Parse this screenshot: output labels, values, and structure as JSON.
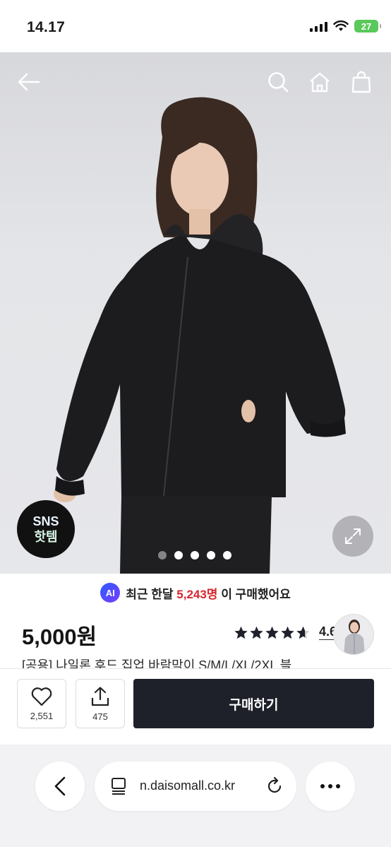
{
  "status_bar": {
    "time": "14.17",
    "battery": "27"
  },
  "hero": {
    "badge_line1": "SNS",
    "badge_line2": "핫템",
    "slide_count": 5,
    "active_slide": 1
  },
  "product": {
    "recent_prefix": "최근 한달",
    "recent_count": "5,243명",
    "recent_suffix": "이 구매했어요",
    "ai_label": "AI",
    "price": "5,000원",
    "rating": "4.6",
    "rating_stars": 4.6,
    "title": "[공용] 나일론 후드 집업 바람막이 S/M/L/XL/2XL 블"
  },
  "actions": {
    "like_count": "2,551",
    "share_count": "475",
    "buy_label": "구매하기"
  },
  "browser": {
    "url": "n.daisomall.co.kr"
  },
  "colors": {
    "accent_red": "#d8262f",
    "buy_button": "#1e212a",
    "battery_green": "#5ac85a"
  }
}
